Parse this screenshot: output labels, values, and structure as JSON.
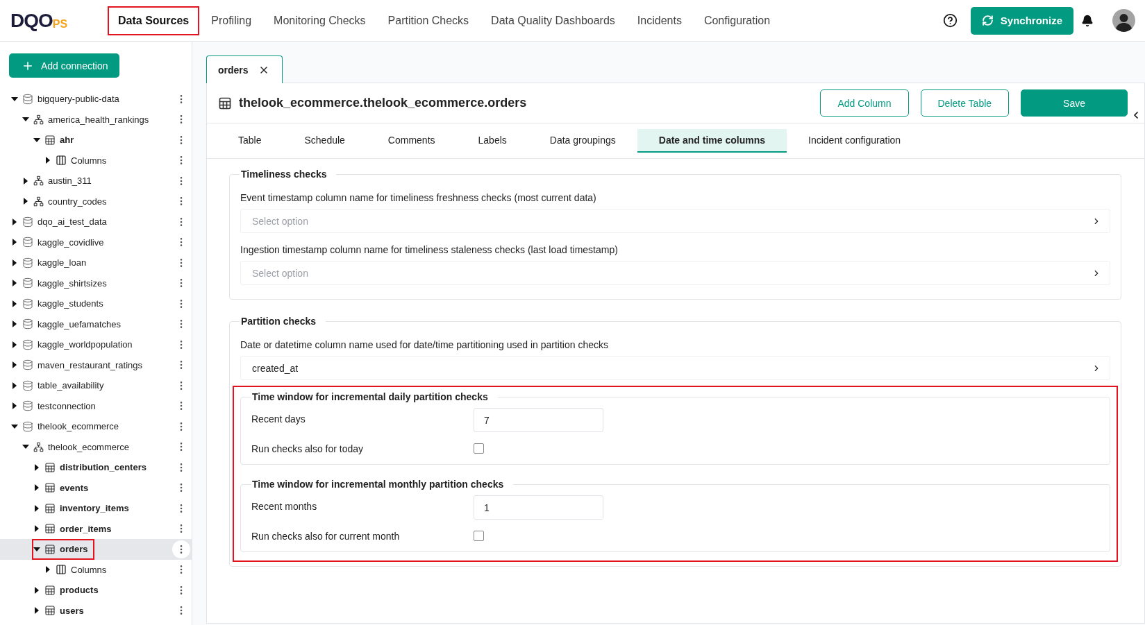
{
  "logo": {
    "main": "DQO",
    "suffix": "PS"
  },
  "nav": [
    {
      "label": "Data Sources",
      "selected": true,
      "highlighted": true
    },
    {
      "label": "Profiling",
      "selected": false
    },
    {
      "label": "Monitoring Checks",
      "selected": false
    },
    {
      "label": "Partition Checks",
      "selected": false
    },
    {
      "label": "Data Quality Dashboards",
      "selected": false
    },
    {
      "label": "Incidents",
      "selected": false
    },
    {
      "label": "Configuration",
      "selected": false
    }
  ],
  "sync_button": "Synchronize",
  "sidebar": {
    "add_button": "Add connection",
    "tree": [
      {
        "label": "bigquery-public-data",
        "kind": "connection",
        "expanded": true,
        "selected": false,
        "children": [
          {
            "label": "america_health_rankings",
            "kind": "schema",
            "expanded": true,
            "selected": false,
            "children": [
              {
                "label": "ahr",
                "kind": "table",
                "expanded": true,
                "selected": false,
                "children": [
                  {
                    "label": "Columns",
                    "kind": "columns",
                    "expanded": false,
                    "selected": false
                  }
                ]
              }
            ]
          },
          {
            "label": "austin_311",
            "kind": "schema",
            "expanded": false,
            "selected": false
          },
          {
            "label": "country_codes",
            "kind": "schema",
            "expanded": false,
            "selected": false
          }
        ]
      },
      {
        "label": "dqo_ai_test_data",
        "kind": "connection",
        "expanded": false,
        "selected": false
      },
      {
        "label": "kaggle_covidlive",
        "kind": "connection",
        "expanded": false,
        "selected": false
      },
      {
        "label": "kaggle_loan",
        "kind": "connection",
        "expanded": false,
        "selected": false
      },
      {
        "label": "kaggle_shirtsizes",
        "kind": "connection",
        "expanded": false,
        "selected": false
      },
      {
        "label": "kaggle_students",
        "kind": "connection",
        "expanded": false,
        "selected": false
      },
      {
        "label": "kaggle_uefamatches",
        "kind": "connection",
        "expanded": false,
        "selected": false
      },
      {
        "label": "kaggle_worldpopulation",
        "kind": "connection",
        "expanded": false,
        "selected": false
      },
      {
        "label": "maven_restaurant_ratings",
        "kind": "connection",
        "expanded": false,
        "selected": false
      },
      {
        "label": "table_availability",
        "kind": "connection",
        "expanded": false,
        "selected": false
      },
      {
        "label": "testconnection",
        "kind": "connection",
        "expanded": false,
        "selected": false
      },
      {
        "label": "thelook_ecommerce",
        "kind": "connection",
        "expanded": true,
        "selected": false,
        "children": [
          {
            "label": "thelook_ecommerce",
            "kind": "schema",
            "expanded": true,
            "selected": false,
            "children": [
              {
                "label": "distribution_centers",
                "kind": "table",
                "expanded": false,
                "selected": false
              },
              {
                "label": "events",
                "kind": "table",
                "expanded": false,
                "selected": false
              },
              {
                "label": "inventory_items",
                "kind": "table",
                "expanded": false,
                "selected": false
              },
              {
                "label": "order_items",
                "kind": "table",
                "expanded": false,
                "selected": false
              },
              {
                "label": "orders",
                "kind": "table",
                "expanded": true,
                "selected": true,
                "highlighted": true,
                "children": [
                  {
                    "label": "Columns",
                    "kind": "columns",
                    "expanded": false,
                    "selected": false
                  }
                ]
              },
              {
                "label": "products",
                "kind": "table",
                "expanded": false,
                "selected": false
              },
              {
                "label": "users",
                "kind": "table",
                "expanded": false,
                "selected": false
              }
            ]
          }
        ]
      }
    ]
  },
  "open_tabs": [
    {
      "label": "orders",
      "selected": true
    }
  ],
  "table_title": "thelook_ecommerce.thelook_ecommerce.orders",
  "actions": [
    {
      "label": "Add Column",
      "kind": "outline"
    },
    {
      "label": "Delete Table",
      "kind": "outline"
    },
    {
      "label": "Save",
      "kind": "primary"
    }
  ],
  "tabs": [
    {
      "label": "Table",
      "selected": false
    },
    {
      "label": "Schedule",
      "selected": false
    },
    {
      "label": "Comments",
      "selected": false
    },
    {
      "label": "Labels",
      "selected": false
    },
    {
      "label": "Data groupings",
      "selected": false
    },
    {
      "label": "Date and time columns",
      "selected": true
    },
    {
      "label": "Incident configuration",
      "selected": false
    }
  ],
  "sections": [
    {
      "title": "Timeliness checks",
      "fields": [
        {
          "label": "Event timestamp column name for timeliness freshness checks (most current data)",
          "placeholder": "Select option"
        },
        {
          "label": "Ingestion timestamp column name for timeliness staleness checks (last load timestamp)",
          "placeholder": "Select option"
        }
      ]
    },
    {
      "title": "Partition checks",
      "fields": [
        {
          "label": "Date or datetime column name used for date/time partitioning used in partition checks",
          "value": "created_at"
        }
      ],
      "highlighted": true,
      "subsections": [
        {
          "title": "Time window for incremental daily partition checks",
          "rows": [
            {
              "kind": "number",
              "label": "Recent days",
              "value": "7"
            },
            {
              "kind": "checkbox",
              "label": "Run checks also for today",
              "checked": false
            }
          ]
        },
        {
          "title": "Time window for incremental monthly partition checks",
          "rows": [
            {
              "kind": "number",
              "label": "Recent months",
              "value": "1"
            },
            {
              "kind": "checkbox",
              "label": "Run checks also for current month",
              "checked": false
            }
          ]
        }
      ]
    }
  ]
}
